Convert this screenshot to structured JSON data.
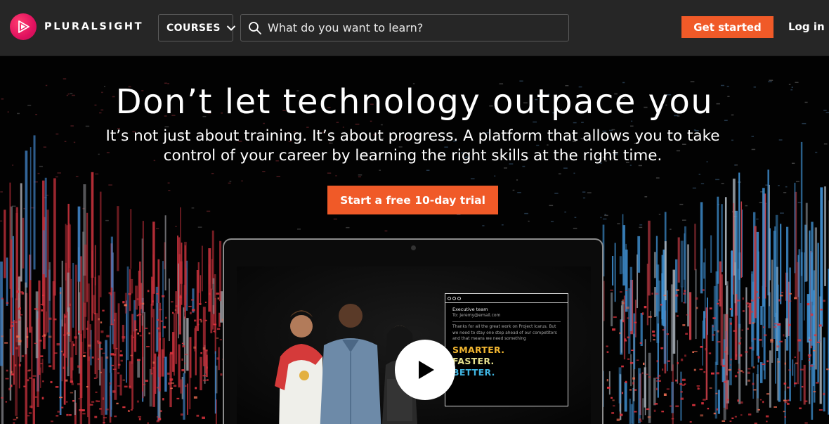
{
  "nav": {
    "brand": "PLURALSIGHT",
    "courses_label": "COURSES",
    "search_placeholder": "What do you want to learn?",
    "get_started_label": "Get started",
    "login_label": "Log in",
    "icons": {
      "logo": "pluralsight-play-logo-icon",
      "courses_chevron": "chevron-down-icon",
      "search": "search-icon"
    }
  },
  "hero": {
    "title": "Don’t let technology outpace you",
    "subtitle_line1": "It’s not just about training. It’s about progress. A platform that allows you to take",
    "subtitle_line2": "control of your career by learning the right skills at the right time.",
    "cta_label": "Start a free 10-day trial",
    "play_icon": "play-icon"
  },
  "video_email": {
    "heading": "Executive team",
    "to": "To: Jeremy@email.com",
    "body": "Thanks for all the great work on Project Icarus. But we need to stay one step ahead of our competitors and that means we need something",
    "words": [
      "SMARTER.",
      "FASTER.",
      "BETTER."
    ]
  },
  "colors": {
    "accent": "#f05a28",
    "nav_bg": "#262626",
    "brand_pink": "#e0115f",
    "smarter": "#f2b630",
    "faster": "#e6e08e",
    "better": "#3fb3e0"
  }
}
